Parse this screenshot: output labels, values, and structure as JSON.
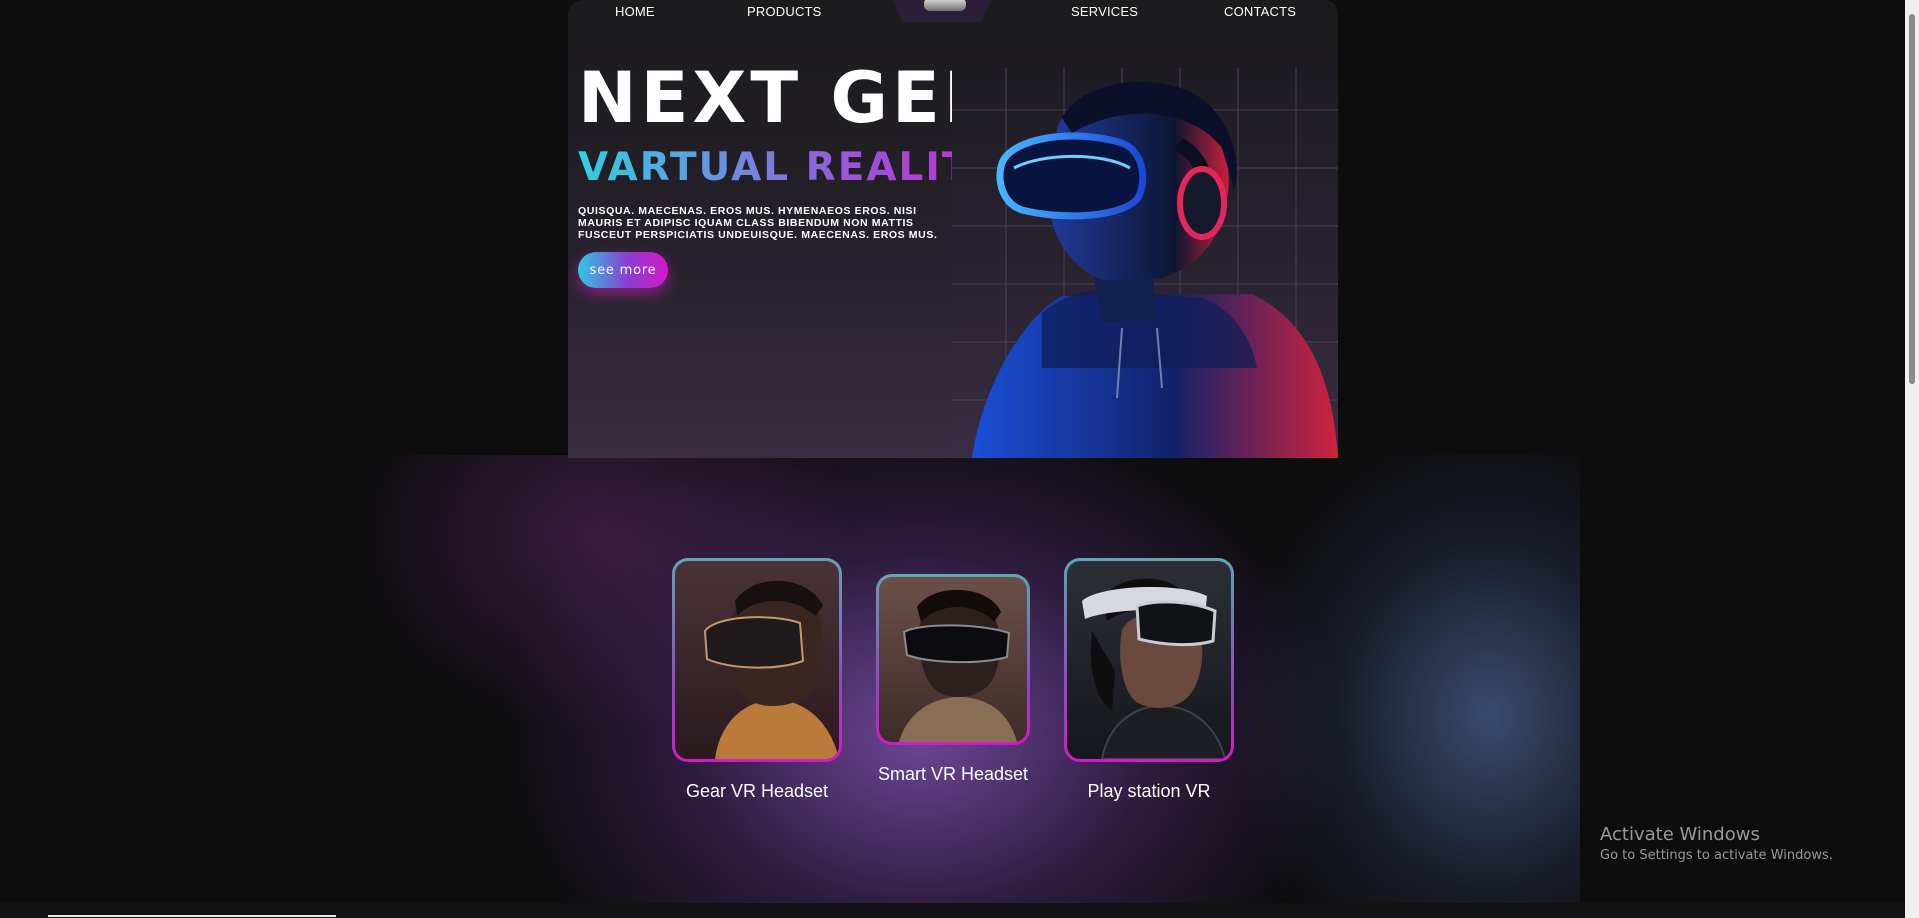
{
  "nav": {
    "home": "HOME",
    "products": "PRODUCTS",
    "services": "SERVICES",
    "contacts": "CONTACTS"
  },
  "hero": {
    "title": "NEXT GEN",
    "subtitle": "VARTUAL REALITY",
    "description": "QUISQUA. MAECENAS. EROS MUS. HYMENAEOS EROS. NISI MAURIS ET ADIPISC IQUAM CLASS BIBENDUM NON MATTIS FUSCEUT PERSPICIATIS UNDEUISQUE. MAECENAS. EROS MUS.",
    "cta_label": "see more"
  },
  "products": [
    {
      "name": "Gear VR Headset"
    },
    {
      "name": "Smart VR Headset"
    },
    {
      "name": "Play station VR"
    }
  ],
  "watermark": {
    "title": "Activate Windows",
    "subtitle": "Go to Settings to activate Windows."
  },
  "colors": {
    "page_bg": "#0d0d0e",
    "accent_cyan": "#2fd0e0",
    "accent_magenta": "#d418c8",
    "accent_purple": "#8a4fbf"
  },
  "icons": {
    "logo": "vr-headset-icon"
  }
}
